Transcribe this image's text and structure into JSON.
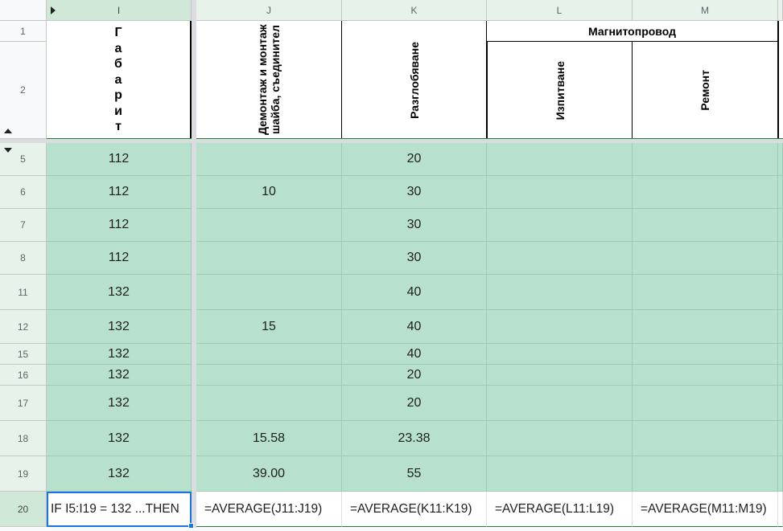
{
  "columns": [
    {
      "letter": "I",
      "selected": true
    },
    {
      "letter": "J"
    },
    {
      "letter": "K"
    },
    {
      "letter": "L"
    },
    {
      "letter": "M"
    }
  ],
  "header": {
    "I_letters": [
      "Г",
      "а",
      "б",
      "а",
      "р",
      "и",
      "т"
    ],
    "J": "Демонтаж и монтаж шайба, съединител",
    "K": "Разглобяване",
    "group_LM": "Магнитопровод",
    "L": "Изпитване",
    "M": "Ремонт"
  },
  "header_rows": [
    "1",
    "2"
  ],
  "rows": [
    {
      "num": "5",
      "I": "112",
      "J": "",
      "K": "20",
      "L": "",
      "M": ""
    },
    {
      "num": "6",
      "I": "112",
      "J": "10",
      "K": "30",
      "L": "",
      "M": ""
    },
    {
      "num": "7",
      "I": "112",
      "J": "",
      "K": "30",
      "L": "",
      "M": ""
    },
    {
      "num": "8",
      "I": "112",
      "J": "",
      "K": "30",
      "L": "",
      "M": ""
    },
    {
      "num": "11",
      "I": "132",
      "J": "",
      "K": "40",
      "L": "",
      "M": ""
    },
    {
      "num": "12",
      "I": "132",
      "J": "15",
      "K": "40",
      "L": "",
      "M": ""
    },
    {
      "num": "15",
      "I": "132",
      "J": "",
      "K": "40",
      "L": "",
      "M": ""
    },
    {
      "num": "16",
      "I": "132",
      "J": "",
      "K": "20",
      "L": "",
      "M": ""
    },
    {
      "num": "17",
      "I": "132",
      "J": "",
      "K": "20",
      "L": "",
      "M": ""
    },
    {
      "num": "18",
      "I": "132",
      "J": "15.58",
      "K": "23.38",
      "L": "",
      "M": ""
    },
    {
      "num": "19",
      "I": "132",
      "J": "39.00",
      "K": "55",
      "L": "",
      "M": ""
    },
    {
      "num": "20",
      "I": "IF I5:I19 = 132 ...THEN",
      "J": "=AVERAGE(J11:J19)",
      "K": "=AVERAGE(K11:K19)",
      "L": "=AVERAGE(L11:L19)",
      "M": "=AVERAGE(M11:M19)"
    }
  ],
  "colors": {
    "fill_green": "#b7e1cd",
    "header_green": "#e6f2ea",
    "selection_blue": "#1a73e8"
  }
}
